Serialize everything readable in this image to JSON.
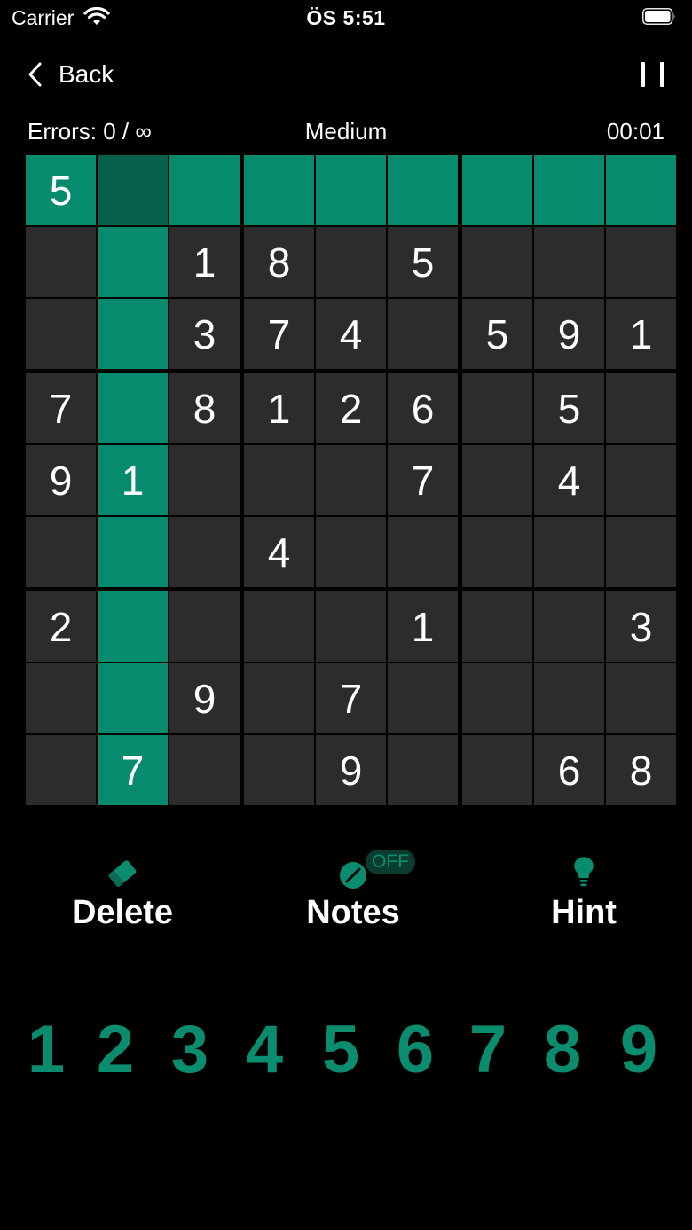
{
  "status_bar": {
    "carrier": "Carrier",
    "time": "ÖS 5:51"
  },
  "nav": {
    "back_label": "Back"
  },
  "info": {
    "errors": "Errors: 0 / ∞",
    "difficulty": "Medium",
    "timer": "00:01"
  },
  "colors": {
    "cell": "#2c2c2e",
    "highlight": "#078b6e",
    "selected": "#06604c",
    "accent": "#0a8d6f"
  },
  "selected_cell": [
    0,
    1
  ],
  "grid": [
    [
      "5",
      "",
      "",
      "",
      "",
      "",
      "",
      "",
      ""
    ],
    [
      "",
      "",
      "1",
      "8",
      "",
      "5",
      "",
      "",
      ""
    ],
    [
      "",
      "",
      "3",
      "7",
      "4",
      "",
      "5",
      "9",
      "1"
    ],
    [
      "7",
      "",
      "8",
      "1",
      "2",
      "6",
      "",
      "5",
      ""
    ],
    [
      "9",
      "1",
      "",
      "",
      "",
      "7",
      "",
      "4",
      ""
    ],
    [
      "",
      "",
      "",
      "4",
      "",
      "",
      "",
      "",
      ""
    ],
    [
      "2",
      "",
      "",
      "",
      "",
      "1",
      "",
      "",
      "3"
    ],
    [
      "",
      "",
      "9",
      "",
      "7",
      "",
      "",
      "",
      ""
    ],
    [
      "",
      "7",
      "",
      "",
      "9",
      "",
      "",
      "6",
      "8"
    ]
  ],
  "tools": {
    "delete": "Delete",
    "notes": "Notes",
    "notes_badge": "OFF",
    "hint": "Hint"
  },
  "numpad": [
    "1",
    "2",
    "3",
    "4",
    "5",
    "6",
    "7",
    "8",
    "9"
  ]
}
